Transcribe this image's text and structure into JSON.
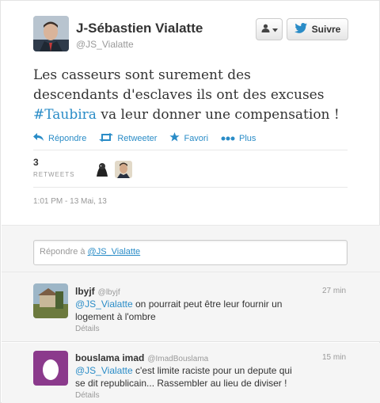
{
  "tweet": {
    "author_name": "J-Sébastien Vialatte",
    "author_handle": "@JS_Vialatte",
    "text_line1": "Les casseurs sont surement des",
    "text_line2": "descendants d'esclaves ils ont des excuses",
    "hashtag": "#Taubira",
    "text_line3_rest": " va leur donner une compensation !",
    "retweet_count": "3",
    "retweets_label": "RETWEETS",
    "timestamp": "1:01 PM - 13 Mai, 13"
  },
  "header": {
    "follow_label": "Suivre",
    "user_icon": "user-icon",
    "follow_icon": "twitter-bird-icon"
  },
  "actions": {
    "reply": "Répondre",
    "retweet": "Retweeter",
    "favorite": "Favori",
    "more": "Plus"
  },
  "reply_box": {
    "placeholder": "Répondre à ",
    "mention": "@JS_Vialatte"
  },
  "replies": [
    {
      "name": "lbyjf",
      "handle": "@lbyjf",
      "time": "27 min",
      "mention": "@JS_Vialatte",
      "text_rest": " on pourrait peut être leur fournir un",
      "text_line2": "logement à l'ombre",
      "details": "Détails"
    },
    {
      "name": "bouslama imad",
      "handle": "@ImadBouslama",
      "time": "15 min",
      "mention": "@JS_Vialatte",
      "text_rest": " c'est limite raciste pour un depute qui",
      "text_line2": "se dit republicain... Rassembler au lieu de diviser !",
      "details": "Détails"
    }
  ],
  "colors": {
    "link": "#2a8cc7",
    "text": "#333333",
    "muted": "#999999",
    "egg_bg": "#8b3a8c"
  }
}
